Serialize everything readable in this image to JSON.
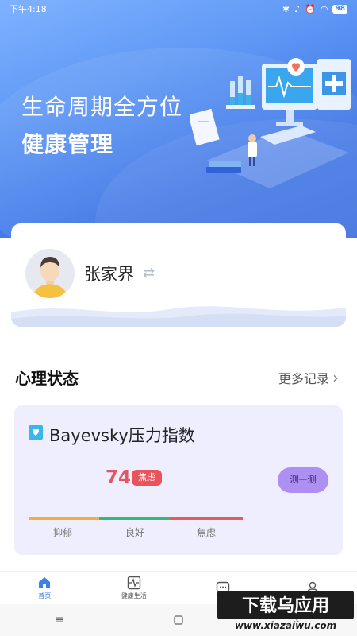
{
  "status_bar": {
    "time": "下午4:18",
    "battery": "98"
  },
  "banner": {
    "line1": "生命周期全方位",
    "line2": "健康管理"
  },
  "profile": {
    "name": "张家界"
  },
  "section": {
    "title": "心理状态",
    "more": "更多记录"
  },
  "pressure": {
    "title": "Bayevsky压力指数",
    "value": "74",
    "status": "焦虑",
    "button": "测一测",
    "levels": [
      "抑郁",
      "良好",
      "焦虑"
    ]
  },
  "bottom_nav": [
    {
      "label": "首页",
      "icon": "home-icon",
      "active": true
    },
    {
      "label": "健康生活",
      "icon": "heartbeat-icon",
      "active": false
    },
    {
      "label": "",
      "icon": "chat-icon",
      "active": false
    },
    {
      "label": "",
      "icon": "user-icon",
      "active": false
    }
  ],
  "watermark": {
    "line1": "下载乌应用",
    "line2": "www.xiazaiwu.com"
  },
  "colors": {
    "accent": "#3f80e6",
    "alert": "#e8545e",
    "button": "#ad90f2",
    "card_bg": "#efeefe"
  }
}
